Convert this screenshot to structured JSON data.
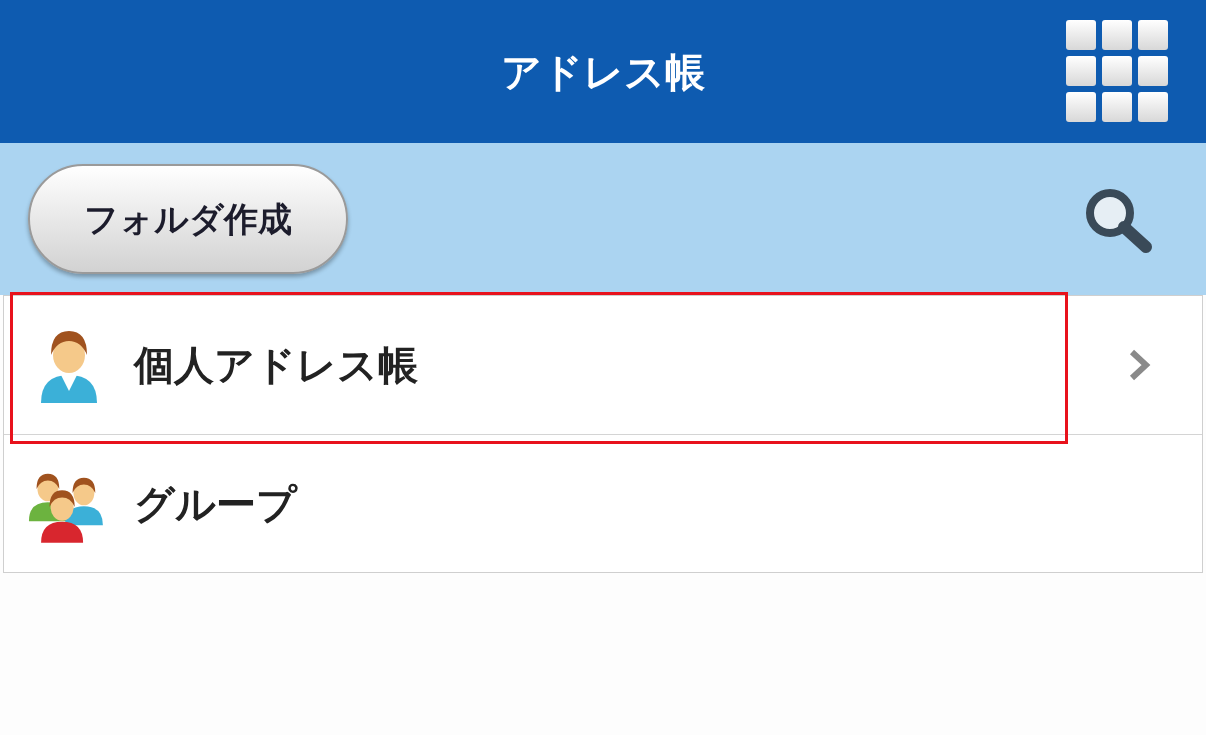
{
  "header": {
    "title": "アドレス帳"
  },
  "toolbar": {
    "button": "フォルダ作成"
  },
  "items": [
    {
      "label": "個人アドレス帳",
      "kind": "person",
      "chevron": true,
      "highlighted": true
    },
    {
      "label": "グループ",
      "kind": "group",
      "chevron": false,
      "highlighted": false
    }
  ]
}
